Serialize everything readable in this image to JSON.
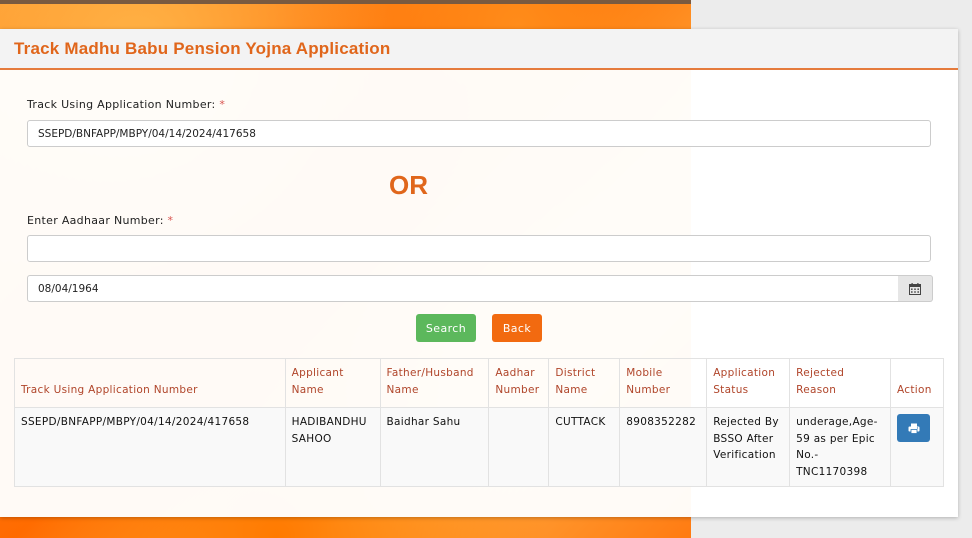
{
  "colors": {
    "accent": "#e0661b",
    "search": "#5cb85c",
    "back": "#f26a10",
    "print": "#337ab7"
  },
  "header": {
    "title": "Track Madhu Babu Pension Yojna Application"
  },
  "form": {
    "app_number_label": "Track Using Application Number:",
    "app_number_value": "SSEPD/BNFAPP/MBPY/04/14/2024/417658",
    "required_mark": "*",
    "or_text": "OR",
    "aadhaar_label": "Enter Aadhaar Number:",
    "aadhaar_value": "",
    "dob_value": "08/04/1964",
    "dob_icon": "calendar-icon",
    "search_label": "Search",
    "back_label": "Back"
  },
  "table": {
    "headers": [
      "Track Using Application Number",
      "Applicant Name",
      "Father/Husband Name",
      "Aadhar Number",
      "District Name",
      "Mobile Number",
      "Application Status",
      "Rejected Reason",
      "Action"
    ],
    "rows": [
      {
        "app_number": "SSEPD/BNFAPP/MBPY/04/14/2024/417658",
        "applicant_name": "HADIBANDHU SAHOO",
        "father_name": "Baidhar Sahu",
        "aadhar": "",
        "district": "CUTTACK",
        "mobile": "8908352282",
        "status": "Rejected By BSSO After Verification",
        "reason": "underage,Age-59 as per Epic No.-TNC1170398",
        "action_icon": "print-icon"
      }
    ]
  }
}
